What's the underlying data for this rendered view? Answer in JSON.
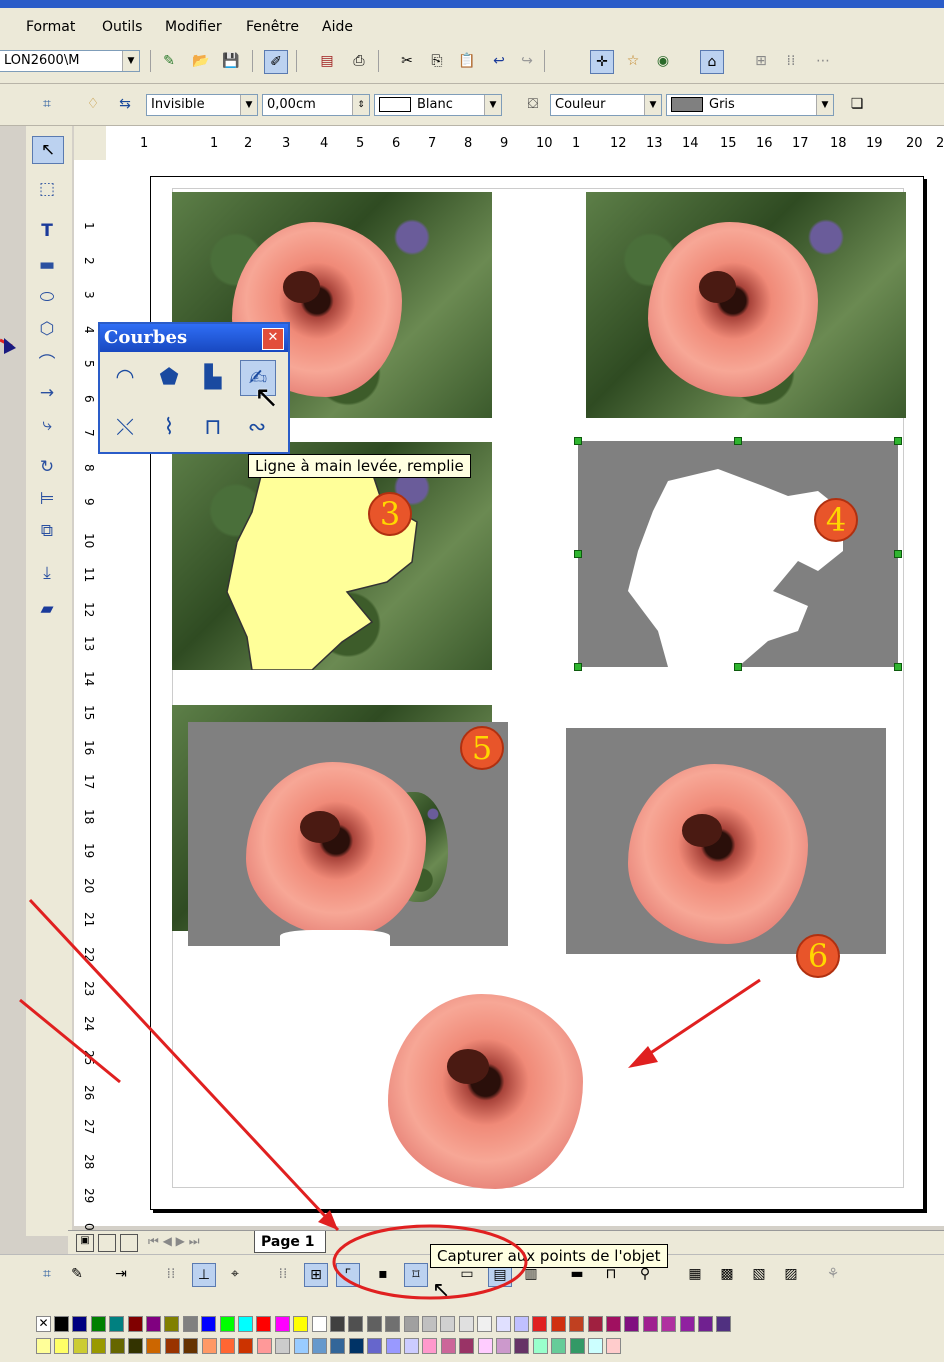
{
  "menu": [
    "Format",
    "Outils",
    "Modifier",
    "Fenêtre",
    "Aide"
  ],
  "toolbar1": {
    "document_combo": "LON2600\\M"
  },
  "toolbar2": {
    "line_style": "Invisible",
    "line_width": "0,00cm",
    "line_color": "Blanc",
    "area_style": "Couleur",
    "area_color": "Gris"
  },
  "ruler_h": [
    "1",
    "1",
    "2",
    "3",
    "4",
    "5",
    "6",
    "7",
    "8",
    "9",
    "10",
    "1",
    "12",
    "13",
    "14",
    "15",
    "16",
    "17",
    "18",
    "19",
    "20",
    "2"
  ],
  "ruler_v": [
    "1",
    "2",
    "3",
    "4",
    "5",
    "6",
    "7",
    "8",
    "9",
    "10",
    "11",
    "12",
    "13",
    "14",
    "15",
    "16",
    "17",
    "18",
    "19",
    "20",
    "21",
    "22",
    "23",
    "24",
    "25",
    "26",
    "27",
    "28",
    "29",
    "0"
  ],
  "courbes_toolbar": {
    "title": "Courbes",
    "tooltip": "Ligne à main levée, remplie"
  },
  "labels": {
    "n3": "3",
    "n4": "4",
    "n5": "5",
    "n6": "6"
  },
  "tabs": {
    "page": "Page 1"
  },
  "bottom_tooltip": "Capturer aux points de l'objet",
  "palette_row1": [
    "#ffffff",
    "#000000",
    "#000080",
    "#008000",
    "#008080",
    "#800000",
    "#800080",
    "#808000",
    "#808080",
    "#0000ff",
    "#00ff00",
    "#00ffff",
    "#ff0000",
    "#ff00ff",
    "#ffff00",
    "#ffffff",
    "#404040",
    "#505050",
    "#606060",
    "#707070",
    "#a0a0a0",
    "#c0c0c0",
    "#d0d0d0",
    "#e0e0e0",
    "#f0f0f0",
    "#e0e0ff",
    "#c0c0ff",
    "#e02020",
    "#d03010",
    "#c04020",
    "#a02040",
    "#a01060",
    "#801080",
    "#a02090",
    "#b030a0",
    "#9020a0",
    "#702090",
    "#503080"
  ],
  "palette_row2": [
    "#ffff99",
    "#ffff66",
    "#cccc33",
    "#999900",
    "#666600",
    "#333300",
    "#cc6600",
    "#993300",
    "#663300",
    "#ff9966",
    "#ff6633",
    "#cc3300",
    "#ff9999",
    "#cccccc",
    "#99ccff",
    "#6699cc",
    "#336699",
    "#003366",
    "#6666cc",
    "#9999ff",
    "#ccccff",
    "#ff99cc",
    "#cc6699",
    "#993366",
    "#ffccff",
    "#cc99cc",
    "#663366",
    "#99ffcc",
    "#66cc99",
    "#339966",
    "#ccffff",
    "#ffcccc"
  ]
}
